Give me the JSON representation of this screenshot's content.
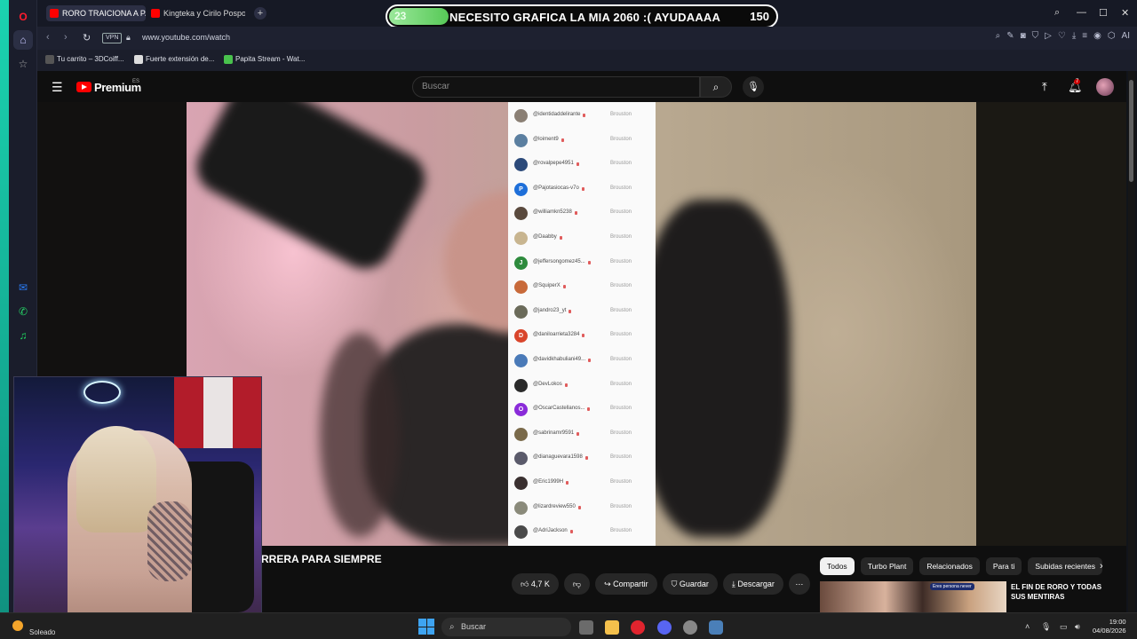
{
  "tabs": [
    {
      "label": "RORO TRAICIONA A PAB",
      "active": true
    },
    {
      "label": "Kingteka y Cirilo Pospo",
      "active": false
    }
  ],
  "goal": {
    "current": "23",
    "text": "NECESITO GRAFICA LA MIA 2060 :( AYUDAAAA",
    "target": "150",
    "progress": 0.153
  },
  "addressbar": {
    "vpn": "VPN",
    "url": "www.youtube.com/watch",
    "ai_label": "AI"
  },
  "bookmarks": [
    {
      "label": "Tu carrito – 3DCoiff..."
    },
    {
      "label": "Fuerte extensión de..."
    },
    {
      "label": "Papita Stream - Wat..."
    }
  ],
  "youtube": {
    "brand": "Premium",
    "country": "ES",
    "search_placeholder": "Buscar",
    "notifications": "7",
    "video_title": "RRERA PARA SIEMPRE",
    "actions": {
      "like": "4,7 K",
      "share": "Compartir",
      "save": "Guardar",
      "download": "Descargar"
    },
    "chips": [
      "Todos",
      "Turbo Plant",
      "Relacionados",
      "Para ti",
      "Subidas recientes"
    ],
    "related_title": "EL FIN DE RORO Y TODAS SUS MENTIRAS",
    "related_badge": "Eres persona never"
  },
  "followers": {
    "status": "Brouston",
    "rows": [
      {
        "handle": "@identidaddelirante",
        "avatar": "",
        "color": "#8a7f74"
      },
      {
        "handle": "@loiment9",
        "avatar": "",
        "color": "#5b7fa0"
      },
      {
        "handle": "@rovalpepe4951",
        "avatar": "",
        "color": "#2c4a7a"
      },
      {
        "handle": "@Pajotasiocas-v7o",
        "avatar": "P",
        "color": "#1e6fd9"
      },
      {
        "handle": "@williamkn5238",
        "avatar": "",
        "color": "#5a4a3e"
      },
      {
        "handle": "@Daabby",
        "avatar": "",
        "color": "#c8b590"
      },
      {
        "handle": "@jeffersongomez45...",
        "avatar": "J",
        "color": "#2e8b3d"
      },
      {
        "handle": "@SquiperX",
        "avatar": "",
        "color": "#c86a3a"
      },
      {
        "handle": "@jandro23_yt",
        "avatar": "",
        "color": "#6b6b5a"
      },
      {
        "handle": "@daniloarrieta3284",
        "avatar": "D",
        "color": "#d9452b"
      },
      {
        "handle": "@davidkhabuliani49...",
        "avatar": "",
        "color": "#4a7ab8"
      },
      {
        "handle": "@DevLokos",
        "avatar": "",
        "color": "#2a2a2a"
      },
      {
        "handle": "@OscarCastellanos...",
        "avatar": "O",
        "color": "#8a2bd9"
      },
      {
        "handle": "@sabrinamr9591",
        "avatar": "",
        "color": "#7a6a4a"
      },
      {
        "handle": "@dianaguevara1598",
        "avatar": "",
        "color": "#5a5a6a"
      },
      {
        "handle": "@Eric1999H",
        "avatar": "",
        "color": "#3a3030"
      },
      {
        "handle": "@lizardreview550",
        "avatar": "",
        "color": "#8a8a7a"
      },
      {
        "handle": "@AdriJackson",
        "avatar": "",
        "color": "#4a4a4a"
      }
    ]
  },
  "taskbar": {
    "weather": "Soleado",
    "search": "Buscar",
    "time": "19:00",
    "date": "04/08/2026"
  }
}
